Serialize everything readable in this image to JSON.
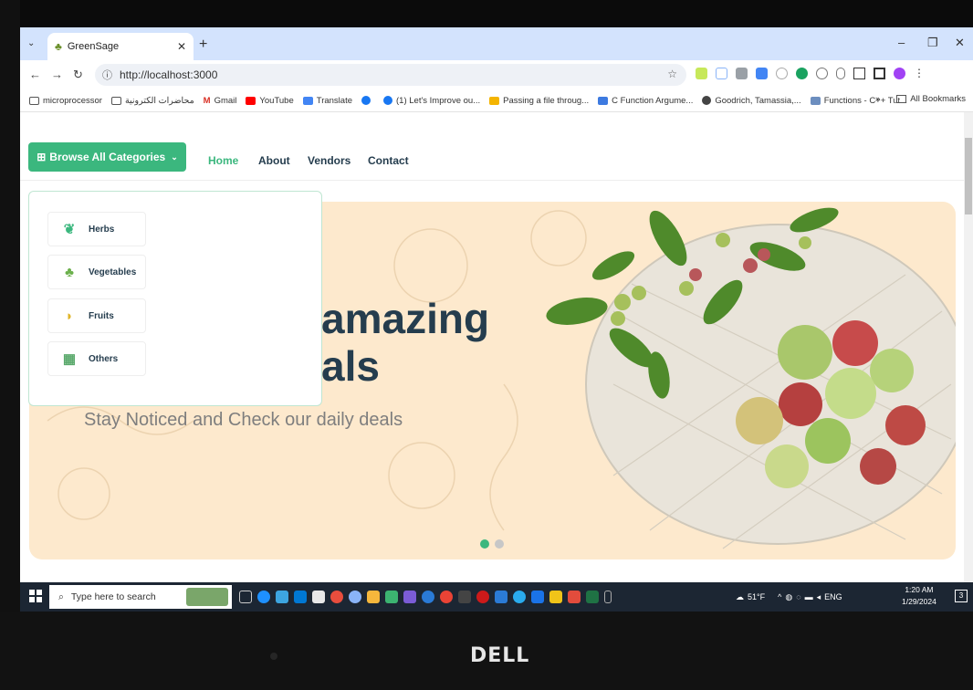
{
  "browser": {
    "tab_title": "GreenSage",
    "url": "http://localhost:3000",
    "bookmarks": [
      "microprocessor",
      "محاضرات الكترونية",
      "Gmail",
      "YouTube",
      "Translate",
      "(1) Let's Improve ou...",
      "Passing a file throug...",
      "C Function Argume...",
      "Goodrich, Tamassia,...",
      "Functions - C++ Tut..."
    ],
    "all_bookmarks": "All Bookmarks"
  },
  "site": {
    "browse_label": "Browse All Categories",
    "menu": [
      "Home",
      "About",
      "Vendors",
      "Contact"
    ],
    "categories": [
      "Herbs",
      "Vegetables",
      "Fruits",
      "Others"
    ],
    "hero": {
      "line1": "amazing",
      "line2": "als",
      "subtitle": "Stay Noticed and Check our daily deals"
    }
  },
  "taskbar": {
    "search_placeholder": "Type here to search",
    "weather": "51°F",
    "lang": "ENG",
    "time": "1:20 AM",
    "date": "1/29/2024",
    "notif_count": "3"
  },
  "device": {
    "brand": "DELL"
  },
  "colors": {
    "accent": "#3bb77e",
    "hero_bg": "#fde9cd",
    "heading": "#253d4e"
  }
}
